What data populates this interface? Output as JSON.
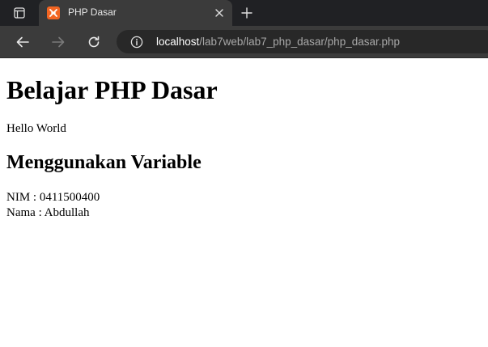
{
  "browser": {
    "tab": {
      "title": "PHP Dasar",
      "favicon": "xampp-icon"
    },
    "address_bar": {
      "host": "localhost",
      "path": "/lab7web/lab7_php_dasar/php_dasar.php"
    },
    "icons": {
      "tab_actions": "tab-actions-icon",
      "close_tab": "close-icon",
      "new_tab": "plus-icon",
      "back": "back-arrow-icon",
      "forward": "forward-arrow-icon",
      "reload": "reload-icon",
      "site_info": "info-icon"
    },
    "colors": {
      "tabstrip": "#202124",
      "toolbar": "#3b3b3b",
      "omnibox": "#282828",
      "favicon": "#f26522"
    }
  },
  "page": {
    "heading": "Belajar PHP Dasar",
    "greeting": "Hello World",
    "subheading": "Menggunakan Variable",
    "nim_line": "NIM : 0411500400",
    "nama_line": "Nama : Abdullah"
  }
}
